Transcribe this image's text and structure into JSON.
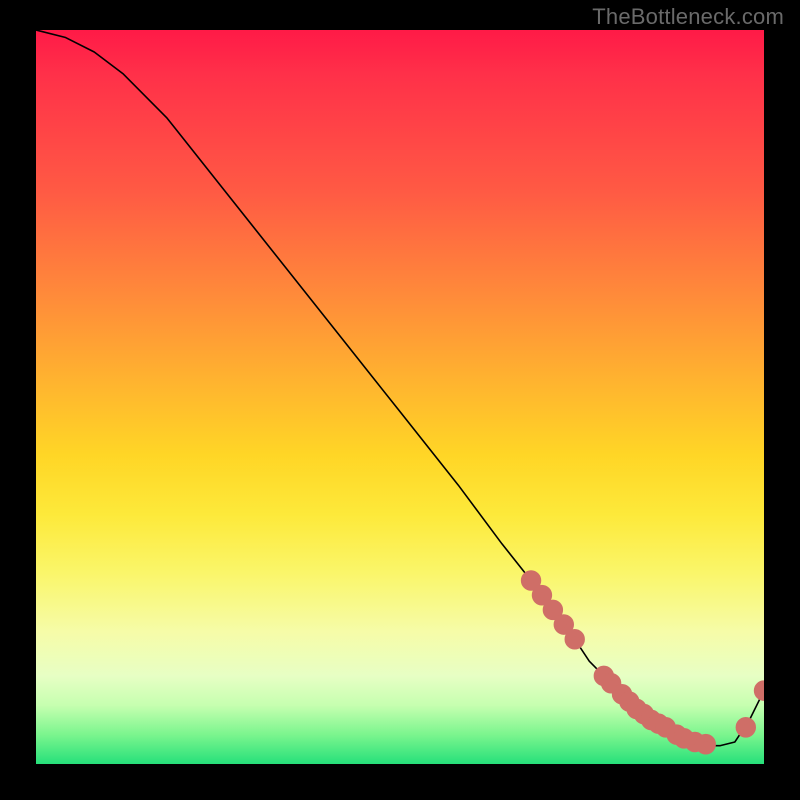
{
  "watermark": "TheBottleneck.com",
  "colors": {
    "dot": "#cf6e67",
    "line": "#000000"
  },
  "chart_data": {
    "type": "line",
    "title": "",
    "xlabel": "",
    "ylabel": "",
    "xlim": [
      0,
      100
    ],
    "ylim": [
      0,
      100
    ],
    "grid": false,
    "series": [
      {
        "name": "curve",
        "x": [
          0,
          4,
          8,
          12,
          18,
          26,
          34,
          42,
          50,
          58,
          64,
          68,
          72,
          74,
          76,
          78,
          80,
          82,
          84,
          86,
          88,
          90,
          92,
          94,
          96,
          98,
          100
        ],
        "values": [
          100,
          99,
          97,
          94,
          88,
          78,
          68,
          58,
          48,
          38,
          30,
          25,
          20,
          17,
          14,
          12,
          10,
          8,
          6,
          5,
          4,
          3,
          2.5,
          2.5,
          3,
          6,
          10
        ]
      }
    ],
    "dots": {
      "comment": "Scattered markers along the lower-right segment of the curve",
      "x": [
        68,
        69.5,
        71,
        72.5,
        74,
        78,
        79,
        80.5,
        81.5,
        82.5,
        83.5,
        84.5,
        85.5,
        86.5,
        88,
        89,
        90.5,
        92,
        97.5,
        100
      ],
      "values": [
        25,
        23,
        21,
        19,
        17,
        12,
        11,
        9.5,
        8.5,
        7.5,
        6.8,
        6.0,
        5.5,
        5.0,
        4,
        3.5,
        3,
        2.7,
        5,
        10
      ]
    }
  }
}
